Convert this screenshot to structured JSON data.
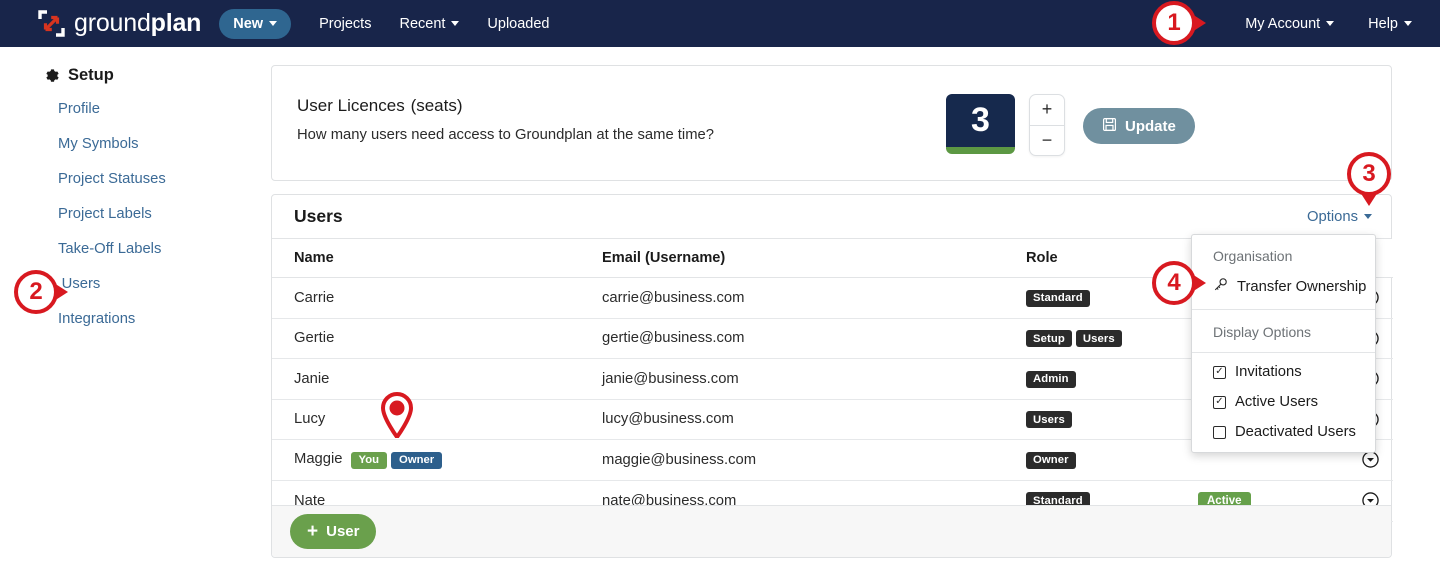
{
  "navbar": {
    "logo_text_light": "ground",
    "logo_text_bold": "plan",
    "logo_icon": "groundplan-expand-arrow-logo",
    "new_label": "New",
    "links": [
      "Projects",
      "Recent",
      "Uploaded"
    ],
    "projects_label": "Projects",
    "recent_label": "Recent",
    "uploaded_label": "Uploaded",
    "my_account_label": "My Account",
    "help_label": "Help",
    "bg_color": "#18254a",
    "new_button_color": "#2f6690"
  },
  "sidebar": {
    "heading": "Setup",
    "heading_icon": "gear-icon",
    "items": [
      {
        "label": "Profile"
      },
      {
        "label": "My Symbols"
      },
      {
        "label": "Project Statuses"
      },
      {
        "label": "Project Labels"
      },
      {
        "label": "Take-Off Labels"
      },
      {
        "label": "Users",
        "expand_icon": "chevron-right-icon",
        "active": true
      },
      {
        "label": "Integrations"
      }
    ],
    "link_color": "#3b6a96"
  },
  "licence_panel": {
    "title": "User Licences",
    "title_suffix": "(seats)",
    "subtitle": "How many users need access to Groundplan at the same time?",
    "seat_count": "3",
    "increment_label": "+",
    "decrement_label": "−",
    "update_label": "Update",
    "update_icon": "save-floppy-icon",
    "seat_box_color": "#16294d",
    "seat_box_underline_color": "#5c9843",
    "update_button_color": "#70909f"
  },
  "users_panel": {
    "title": "Users",
    "options_label": "Options",
    "options_caret_icon": "caret-down-icon",
    "columns": [
      "Name",
      "Email (Username)",
      "Role",
      "",
      ""
    ],
    "col_name": "Name",
    "col_email": "Email (Username)",
    "col_role": "Role",
    "rows": [
      {
        "name": "Carrie",
        "email": "carrie@business.com",
        "roles": [
          "Standard"
        ],
        "tags": [],
        "status": "",
        "action_icon": "circle-chevron-down-icon"
      },
      {
        "name": "Gertie",
        "email": "gertie@business.com",
        "roles": [
          "Setup",
          "Users"
        ],
        "tags": [],
        "status": "",
        "action_icon": "circle-chevron-down-icon"
      },
      {
        "name": "Janie",
        "email": "janie@business.com",
        "roles": [
          "Admin"
        ],
        "tags": [],
        "status": "",
        "action_icon": "circle-chevron-down-icon"
      },
      {
        "name": "Lucy",
        "email": "lucy@business.com",
        "roles": [
          "Users"
        ],
        "tags": [],
        "status": "",
        "action_icon": "circle-chevron-down-icon"
      },
      {
        "name": "Maggie",
        "email": "maggie@business.com",
        "roles": [
          "Owner"
        ],
        "tags": [
          "You",
          "Owner"
        ],
        "status": "",
        "action_icon": "circle-chevron-down-icon"
      },
      {
        "name": "Nate",
        "email": "nate@business.com",
        "roles": [
          "Standard"
        ],
        "tags": [],
        "status": "Active",
        "action_icon": "circle-chevron-down-icon"
      }
    ],
    "add_user_label": "User",
    "add_user_icon": "plus-icon",
    "add_user_color": "#6aa04c",
    "role_badge_color": "#2b2b2b",
    "you_badge_color": "#6aa04c",
    "owner_badge_color": "#2d5f8c",
    "active_badge_color": "#66a04a"
  },
  "options_dropdown": {
    "group_1_label": "Organisation",
    "transfer_ownership_label": "Transfer Ownership",
    "transfer_ownership_icon": "key-icon",
    "group_2_label": "Display Options",
    "checkboxes": [
      {
        "label": "Invitations",
        "checked": true
      },
      {
        "label": "Active Users",
        "checked": true
      },
      {
        "label": "Deactivated Users",
        "checked": false
      }
    ],
    "check_glyph": "✓"
  },
  "annotations": {
    "color": "#d81920",
    "markers": [
      {
        "number": "1",
        "points_to": "my-account-menu",
        "direction": "right"
      },
      {
        "number": "2",
        "points_to": "sidebar-item-users",
        "direction": "right"
      },
      {
        "number": "3",
        "points_to": "options-dropdown-toggle",
        "direction": "down"
      },
      {
        "number": "4",
        "points_to": "transfer-ownership-menu-item",
        "direction": "right"
      }
    ],
    "pin": {
      "points_to": "lucy-row",
      "shape": "map-pin"
    }
  }
}
